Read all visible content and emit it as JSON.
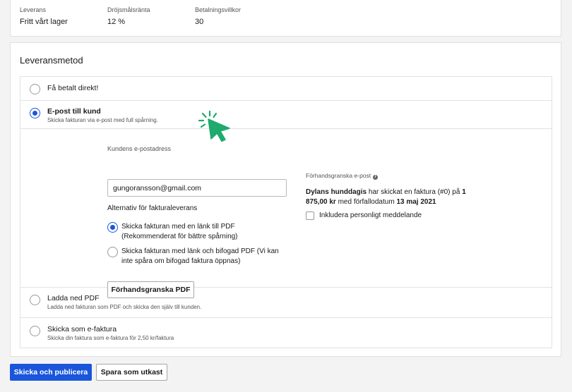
{
  "summary": {
    "delivery_label": "Leverans",
    "delivery_value": "Fritt vårt lager",
    "interest_label": "Dröjsmålsränta",
    "interest_value": "12 %",
    "terms_label": "Betalningsvillkor",
    "terms_value": "30"
  },
  "delivery_method": {
    "title": "Leveransmetod",
    "options": [
      {
        "title": "Få betalt direkt!",
        "subtitle": "",
        "selected": false
      },
      {
        "title": "E-post till kund",
        "subtitle": "Skicka fakturan via e-post med full spårning.",
        "selected": true
      },
      {
        "title": "Ladda ned PDF",
        "subtitle": "Ladda ned fakturan som PDF och skicka den själv till kunden.",
        "selected": false
      },
      {
        "title": "Skicka som e-faktura",
        "subtitle": "Skicka din faktura som e-faktura för 2,50 kr/faktura",
        "selected": false
      }
    ],
    "email_panel": {
      "email_label": "Kundens e-postadress",
      "email_value": "gungoransson@gmail.com",
      "alternatives_label": "Alternativ för fakturaleverans",
      "alternatives": [
        {
          "text": "Skicka fakturan med en länk till PDF (Rekommenderat för bättre spårning)",
          "selected": true
        },
        {
          "text": "Skicka fakturan med länk och bifogad PDF (Vi kan inte spåra om bifogad faktura öppnas)",
          "selected": false
        }
      ],
      "preview_pdf_button": "Förhandsgranska PDF",
      "preview_email_label": "Förhandsgranska e-post",
      "preview_sender": "Dylans hunddagis",
      "preview_text_1": " har skickat en faktura (#0) på ",
      "preview_amount": "1 875,00 kr",
      "preview_text_2": " med förfallodatum ",
      "preview_date": "13 maj 2021",
      "personal_message_label": "Inkludera personligt meddelande"
    }
  },
  "actions": {
    "publish_button": "Skicka och publicera",
    "draft_button": "Spara som utkast"
  },
  "colors": {
    "primary": "#1a56db",
    "cursor": "#1faa6e"
  }
}
